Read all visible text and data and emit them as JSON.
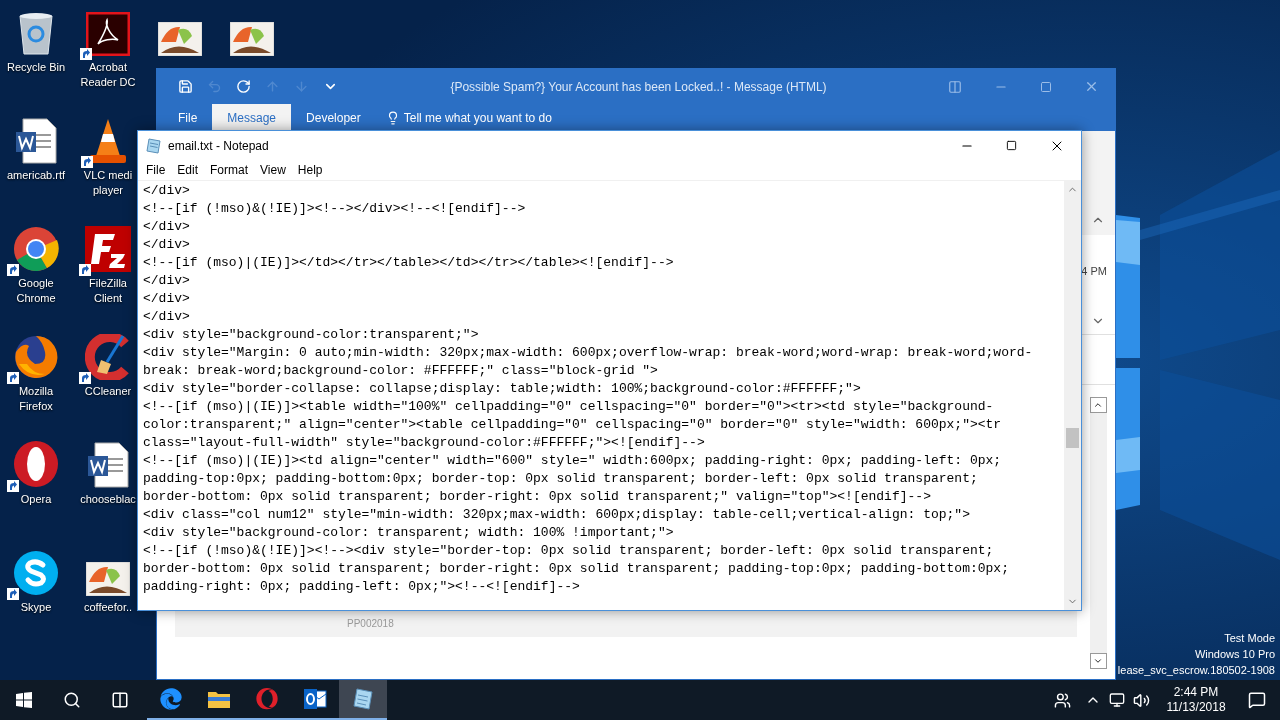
{
  "desktop_columns": [
    [
      {
        "kind": "recycle",
        "label": [
          "Recycle Bin"
        ],
        "shortcut": false
      },
      {
        "kind": "word",
        "label": [
          "americab.rtf"
        ],
        "shortcut": false
      },
      {
        "kind": "chrome",
        "label": [
          "Google",
          "Chrome"
        ],
        "shortcut": true
      },
      {
        "kind": "firefox",
        "label": [
          "Mozilla",
          "Firefox"
        ],
        "shortcut": true
      },
      {
        "kind": "opera",
        "label": [
          "Opera"
        ],
        "shortcut": true
      },
      {
        "kind": "skype",
        "label": [
          "Skype"
        ],
        "shortcut": true
      }
    ],
    [
      {
        "kind": "acrobat",
        "label": [
          "Acrobat",
          "Reader DC"
        ],
        "shortcut": true
      },
      {
        "kind": "vlc",
        "label": [
          "VLC medi",
          "player"
        ],
        "shortcut": true
      },
      {
        "kind": "filezilla",
        "label": [
          "FileZilla",
          "Client"
        ],
        "shortcut": true
      },
      {
        "kind": "ccleaner",
        "label": [
          "CCleaner"
        ],
        "shortcut": true
      },
      {
        "kind": "word",
        "label": [
          "chooseblac"
        ],
        "shortcut": false
      },
      {
        "kind": "image",
        "label": [
          "coffeefor.."
        ],
        "shortcut": false
      }
    ],
    [
      {
        "kind": "image",
        "shortcut": false
      }
    ],
    [
      {
        "kind": "image",
        "shortcut": false
      }
    ]
  ],
  "outlook_window": {
    "title": "{Possible Spam?} Your Account has been Locked..! - Message (HTML)",
    "quick_access": [
      {
        "kind": "save",
        "disabled": false
      },
      {
        "kind": "undo",
        "disabled": true
      },
      {
        "kind": "redo",
        "disabled": false
      },
      {
        "kind": "up",
        "disabled": true
      },
      {
        "kind": "down",
        "disabled": true
      },
      {
        "kind": "customize",
        "disabled": false
      }
    ],
    "tabs": [
      {
        "label": "File",
        "selected": false
      },
      {
        "label": "Message",
        "selected": true
      },
      {
        "label": "Developer",
        "selected": false
      }
    ],
    "tell_me": "Tell me what you want to do",
    "time_fragment": "4 PM",
    "footer_code": "PP002018"
  },
  "notepad": {
    "title": "email.txt - Notepad",
    "menu": [
      "File",
      "Edit",
      "Format",
      "View",
      "Help"
    ],
    "lines": [
      "</div>",
      "<!--[if (!mso)&(!IE)]><!--></div><!--<![endif]-->",
      "</div>",
      "</div>",
      "<!--[if (mso)|(IE)]></td></tr></table></td></tr></table><![endif]-->",
      "</div>",
      "</div>",
      "</div>",
      "<div style=\"background-color:transparent;\">",
      "<div style=\"Margin: 0 auto;min-width: 320px;max-width: 600px;overflow-wrap: break-word;word-wrap: break-word;word-",
      "break: break-word;background-color: #FFFFFF;\" class=\"block-grid \">",
      "<div style=\"border-collapse: collapse;display: table;width: 100%;background-color:#FFFFFF;\">",
      "<!--[if (mso)|(IE)]><table width=\"100%\" cellpadding=\"0\" cellspacing=\"0\" border=\"0\"><tr><td style=\"background-",
      "color:transparent;\" align=\"center\"><table cellpadding=\"0\" cellspacing=\"0\" border=\"0\" style=\"width: 600px;\"><tr",
      "class=\"layout-full-width\" style=\"background-color:#FFFFFF;\"><![endif]-->",
      "<!--[if (mso)|(IE)]><td align=\"center\" width=\"600\" style=\" width:600px; padding-right: 0px; padding-left: 0px;",
      "padding-top:0px; padding-bottom:0px; border-top: 0px solid transparent; border-left: 0px solid transparent;",
      "border-bottom: 0px solid transparent; border-right: 0px solid transparent;\" valign=\"top\"><![endif]-->",
      "<div class=\"col num12\" style=\"min-width: 320px;max-width: 600px;display: table-cell;vertical-align: top;\">",
      "<div style=\"background-color: transparent; width: 100% !important;\">",
      "<!--[if (!mso)&(!IE)]><!--><div style=\"border-top: 0px solid transparent; border-left: 0px solid transparent;",
      "border-bottom: 0px solid transparent; border-right: 0px solid transparent; padding-top:0px; padding-bottom:0px;",
      "padding-right: 0px; padding-left: 0px;\"><!--<![endif]-->"
    ]
  },
  "desktop_info": [
    "Test Mode",
    "Windows 10 Pro",
    "lease_svc_escrow.180502-1908"
  ],
  "taskbar": {
    "apps": [
      {
        "kind": "edge",
        "selected": false
      },
      {
        "kind": "explorer",
        "selected": false
      },
      {
        "kind": "opera",
        "selected": false
      },
      {
        "kind": "outlook",
        "selected": false
      },
      {
        "kind": "notepad",
        "selected": true
      }
    ],
    "time": "2:44 PM",
    "date": "11/13/2018"
  }
}
